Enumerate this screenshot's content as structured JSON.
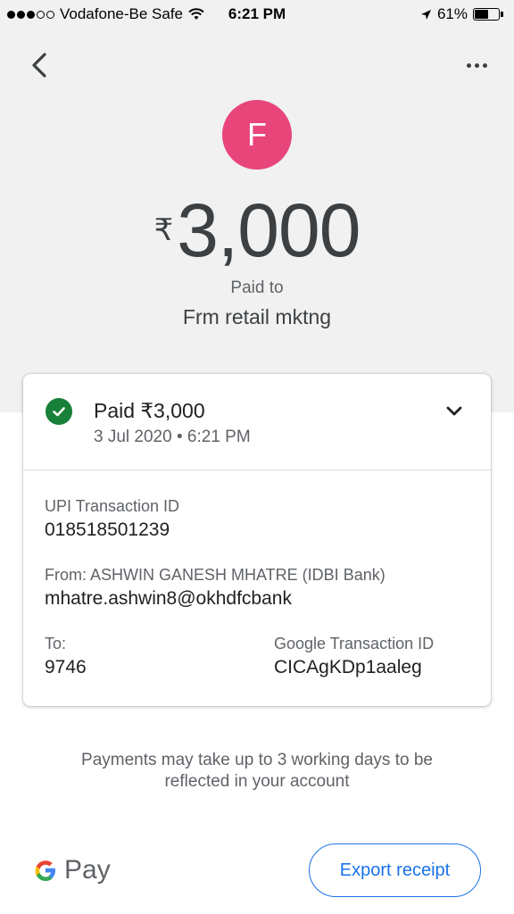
{
  "status_bar": {
    "carrier": "Vodafone-Be Safe",
    "time": "6:21 PM",
    "battery": "61%",
    "battery_level": 0.61,
    "signal_bars_filled": 3,
    "signal_bars_total": 5
  },
  "header": {
    "back_icon": "chevron-left-icon",
    "more_icon": "more-horizontal-icon"
  },
  "payee": {
    "avatar_letter": "F",
    "avatar_color": "#e8457a",
    "currency_symbol": "₹",
    "amount": "3,000",
    "paid_to_label": "Paid to",
    "name": "Frm retail mktng"
  },
  "card": {
    "status": "Paid ₹3,000",
    "date": "3 Jul 2020",
    "time": "6:21 PM",
    "upi_label": "UPI Transaction ID",
    "upi_value": "018518501239",
    "from_label": "From: ASHWIN GANESH MHATRE (IDBI Bank)",
    "from_value": "mhatre.ashwin8@okhdfcbank",
    "to_label": "To:",
    "to_value": "9746",
    "google_id_label": "Google Transaction ID",
    "google_id_value": "CICAgKDp1aaleg",
    "status_color": "#188038"
  },
  "footer": {
    "notice": "Payments may take up to 3 working days to be reflected in your account",
    "brand": "Pay",
    "export_label": "Export receipt",
    "accent_color": "#1a73e8"
  }
}
